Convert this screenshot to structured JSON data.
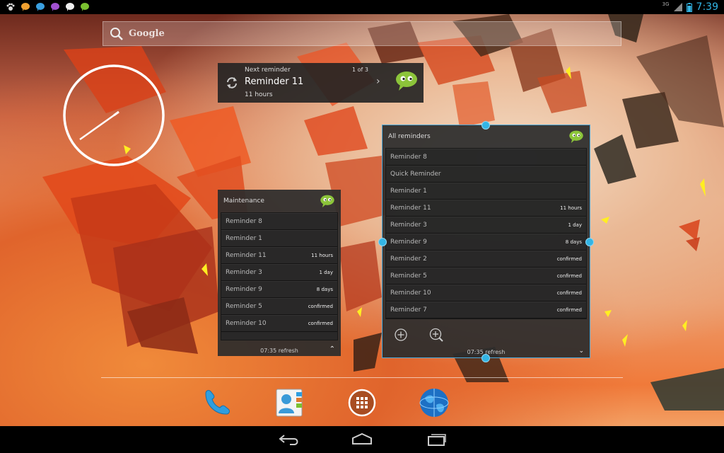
{
  "status_bar": {
    "notification_icons": [
      "paw-icon",
      "chat-bubble-orange-icon",
      "chat-bubble-blue-icon",
      "chat-bubble-purple-icon",
      "chat-bubble-white-icon",
      "chat-bubble-green-icon"
    ],
    "network": "3G",
    "time": "7:39"
  },
  "search": {
    "label": "Google"
  },
  "next_reminder": {
    "heading": "Next reminder",
    "counter": "1 of 3",
    "title": "Reminder 11",
    "due": "11 hours"
  },
  "maintenance_widget": {
    "title": "Maintenance",
    "rows": [
      {
        "name": "Reminder 8",
        "due": ""
      },
      {
        "name": "Reminder 1",
        "due": ""
      },
      {
        "name": "Reminder 11",
        "due": "11 hours"
      },
      {
        "name": "Reminder 3",
        "due": "1 day"
      },
      {
        "name": "Reminder 9",
        "due": "8 days"
      },
      {
        "name": "Reminder 5",
        "due": "confirmed"
      },
      {
        "name": "Reminder 10",
        "due": "confirmed"
      }
    ],
    "footer": "07:35 refresh"
  },
  "all_reminders_widget": {
    "title": "All reminders",
    "rows": [
      {
        "name": "Reminder 8",
        "due": ""
      },
      {
        "name": "Quick Reminder",
        "due": ""
      },
      {
        "name": "Reminder 1",
        "due": ""
      },
      {
        "name": "Reminder 11",
        "due": "11 hours"
      },
      {
        "name": "Reminder 3",
        "due": "1 day"
      },
      {
        "name": "Reminder 9",
        "due": "8 days"
      },
      {
        "name": "Reminder 2",
        "due": "confirmed"
      },
      {
        "name": "Reminder 5",
        "due": "confirmed"
      },
      {
        "name": "Reminder 10",
        "due": "confirmed"
      },
      {
        "name": "Reminder 7",
        "due": "confirmed"
      }
    ],
    "footer": "07:35 refresh"
  },
  "dock": [
    "phone-icon",
    "contacts-icon",
    "app-drawer-icon",
    "browser-globe-icon"
  ],
  "navigation": [
    "back-icon",
    "home-icon",
    "recent-apps-icon"
  ],
  "colors": {
    "accent": "#33b5e5",
    "widget_bg": "#2c2c2c"
  }
}
